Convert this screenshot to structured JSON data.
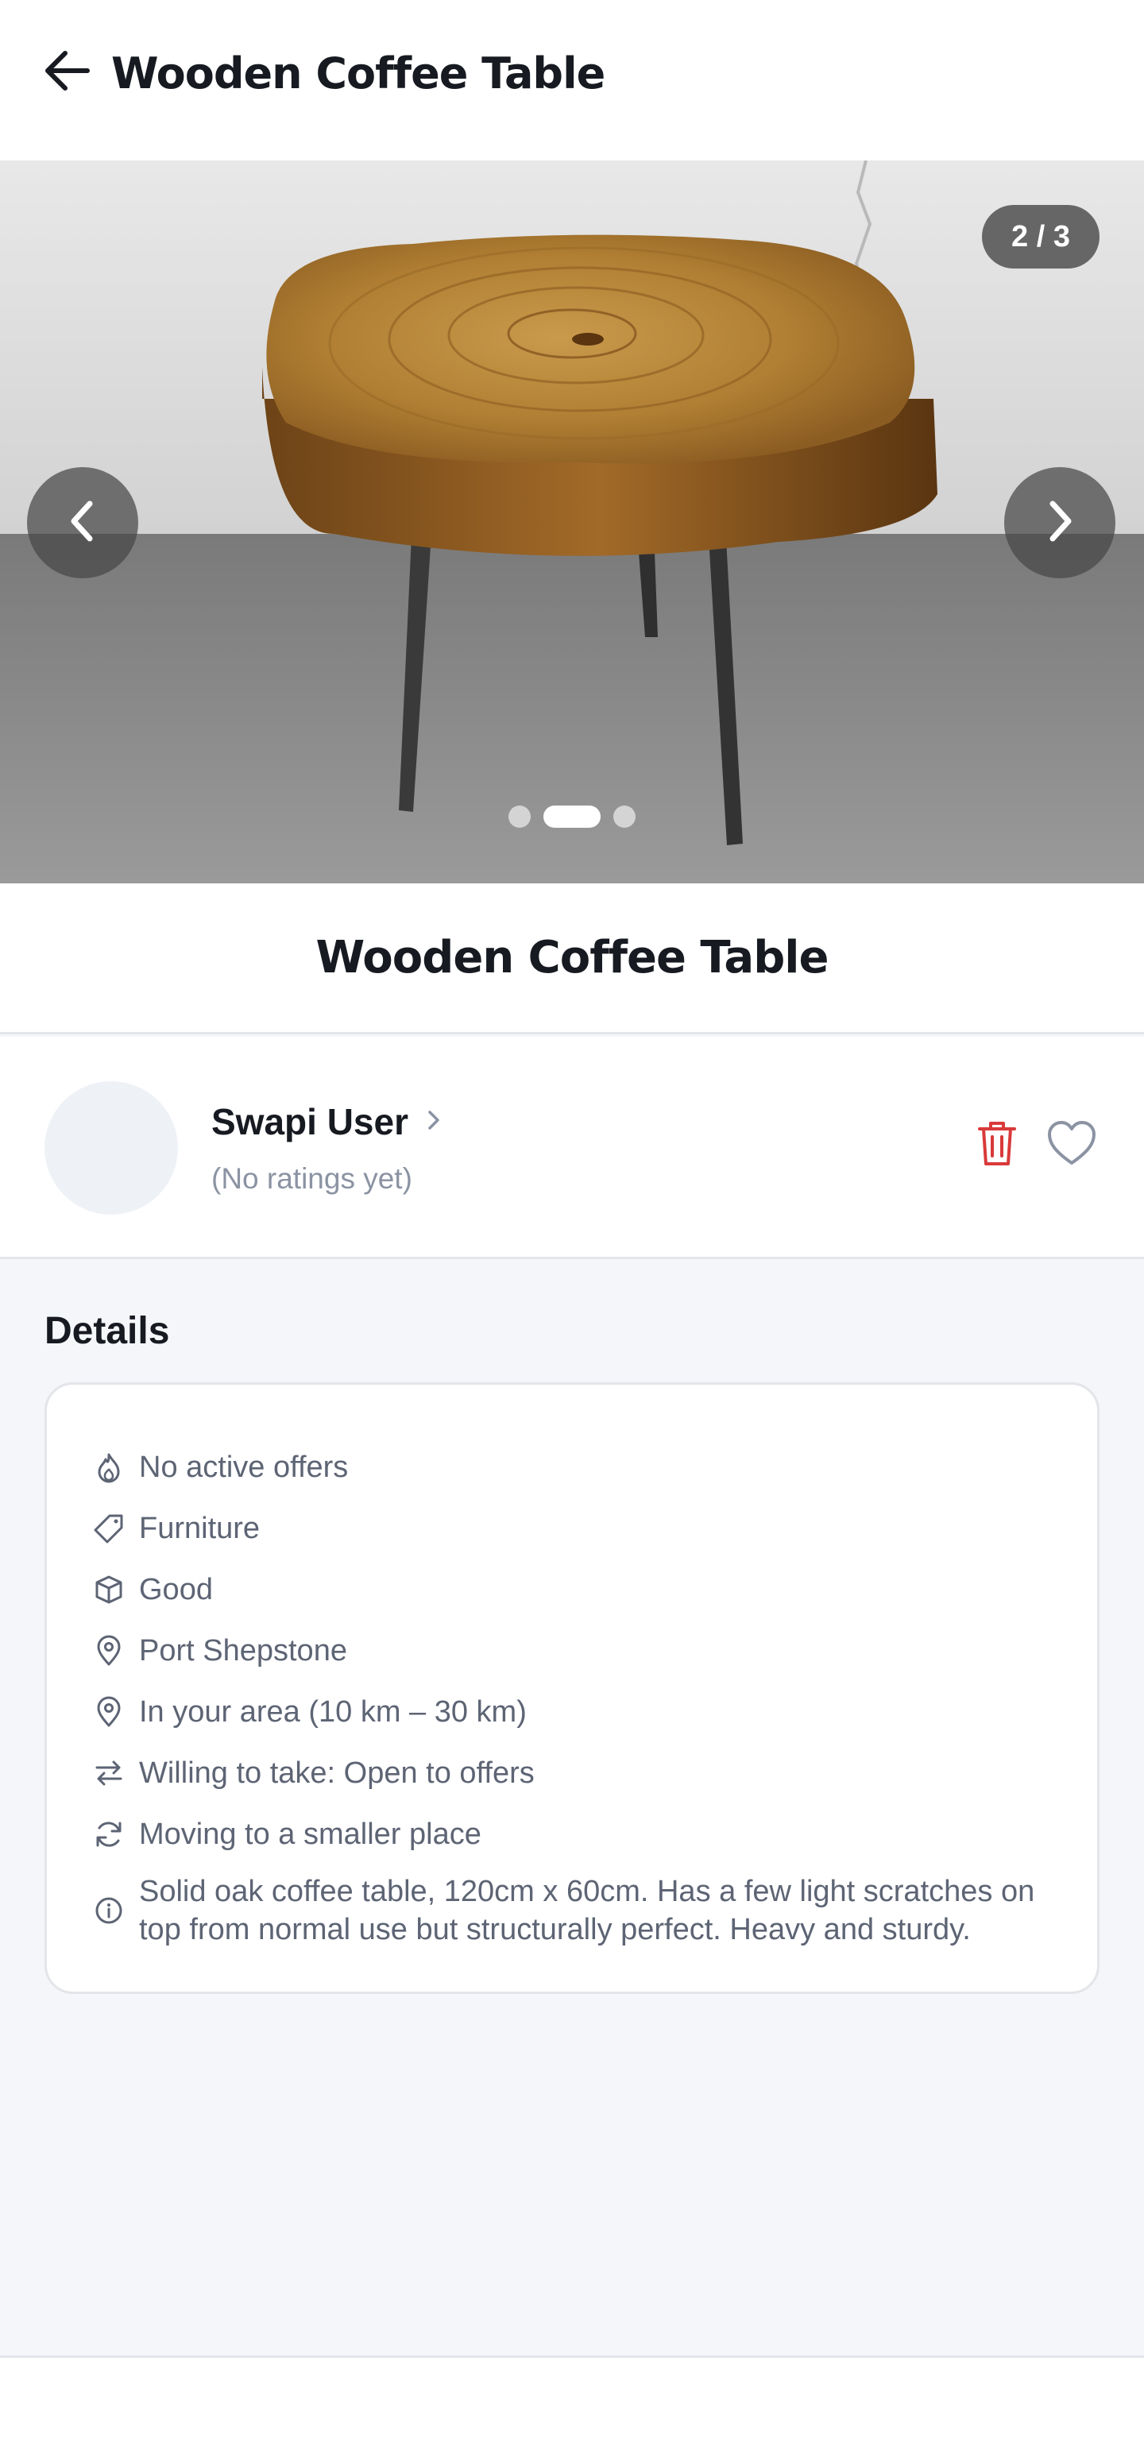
{
  "header": {
    "title": "Wooden Coffee Table",
    "back_icon": "arrow-left-icon"
  },
  "gallery": {
    "counter": "2 / 3",
    "current_image": 2,
    "total_images": 3,
    "prev_icon": "chevron-left-icon",
    "next_icon": "chevron-right-icon"
  },
  "item": {
    "title": "Wooden Coffee Table"
  },
  "seller": {
    "name": "Swapi User",
    "rating": "(No ratings yet)",
    "delete_icon": "trash-icon",
    "favorite_icon": "heart-icon",
    "delete_color": "#d93a3a"
  },
  "details": {
    "heading": "Details",
    "rows": [
      {
        "icon": "flame-icon",
        "text": "No active offers"
      },
      {
        "icon": "tag-icon",
        "text": "Furniture"
      },
      {
        "icon": "box-icon",
        "text": "Good"
      },
      {
        "icon": "map-pin-icon",
        "text": "Port Shepstone"
      },
      {
        "icon": "map-pin-icon",
        "text": "In your area (10 km – 30 km)"
      },
      {
        "icon": "swap-arrows-icon",
        "text": "Willing to take: Open to offers"
      },
      {
        "icon": "refresh-icon",
        "text": "Moving to a smaller place"
      },
      {
        "icon": "info-icon",
        "text": "Solid oak coffee table, 120cm x 60cm. Has a few light scratches on top from normal use but structurally perfect. Heavy and sturdy."
      }
    ]
  }
}
